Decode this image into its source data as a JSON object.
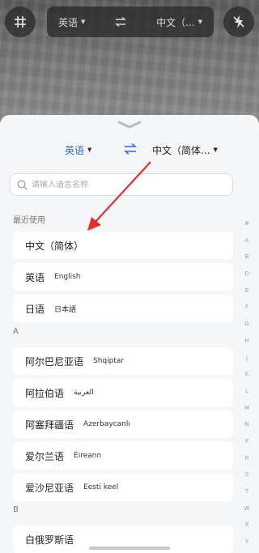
{
  "camera_bar": {
    "source_lang": "英语",
    "target_lang": "中文（...",
    "left_icon": "grid-icon",
    "right_icon": "flash-off-icon",
    "swap_icon": "swap-icon"
  },
  "sheet": {
    "source_lang": "英语",
    "target_lang": "中文（简体...",
    "source_color": "#2a6bd8",
    "search_placeholder": "请输入语言名称"
  },
  "recent": {
    "title": "最近使用",
    "items": [
      {
        "name": "中文（简体）",
        "native": ""
      },
      {
        "name": "英语",
        "native": "English"
      },
      {
        "name": "日语",
        "native": "日本語"
      }
    ]
  },
  "section_a": {
    "title": "A",
    "items": [
      {
        "name": "阿尔巴尼亚语",
        "native": "Shqiptar"
      },
      {
        "name": "阿拉伯语",
        "native": "العربية"
      },
      {
        "name": "阿塞拜疆语",
        "native": "Azerbaycanlı"
      },
      {
        "name": "爱尔兰语",
        "native": "Éireann"
      },
      {
        "name": "爱沙尼亚语",
        "native": "Eesti keel"
      }
    ]
  },
  "section_b": {
    "title": "B",
    "partial_item": "白俄罗斯语"
  },
  "alpha_index": [
    "#",
    "A",
    "B",
    "D",
    "E",
    "F",
    "G",
    "H",
    "J",
    "K",
    "L",
    "M",
    "N",
    "P",
    "R",
    "S",
    "T",
    "W",
    "X",
    "Y",
    "Z"
  ],
  "annotation_color": "#e0302a"
}
